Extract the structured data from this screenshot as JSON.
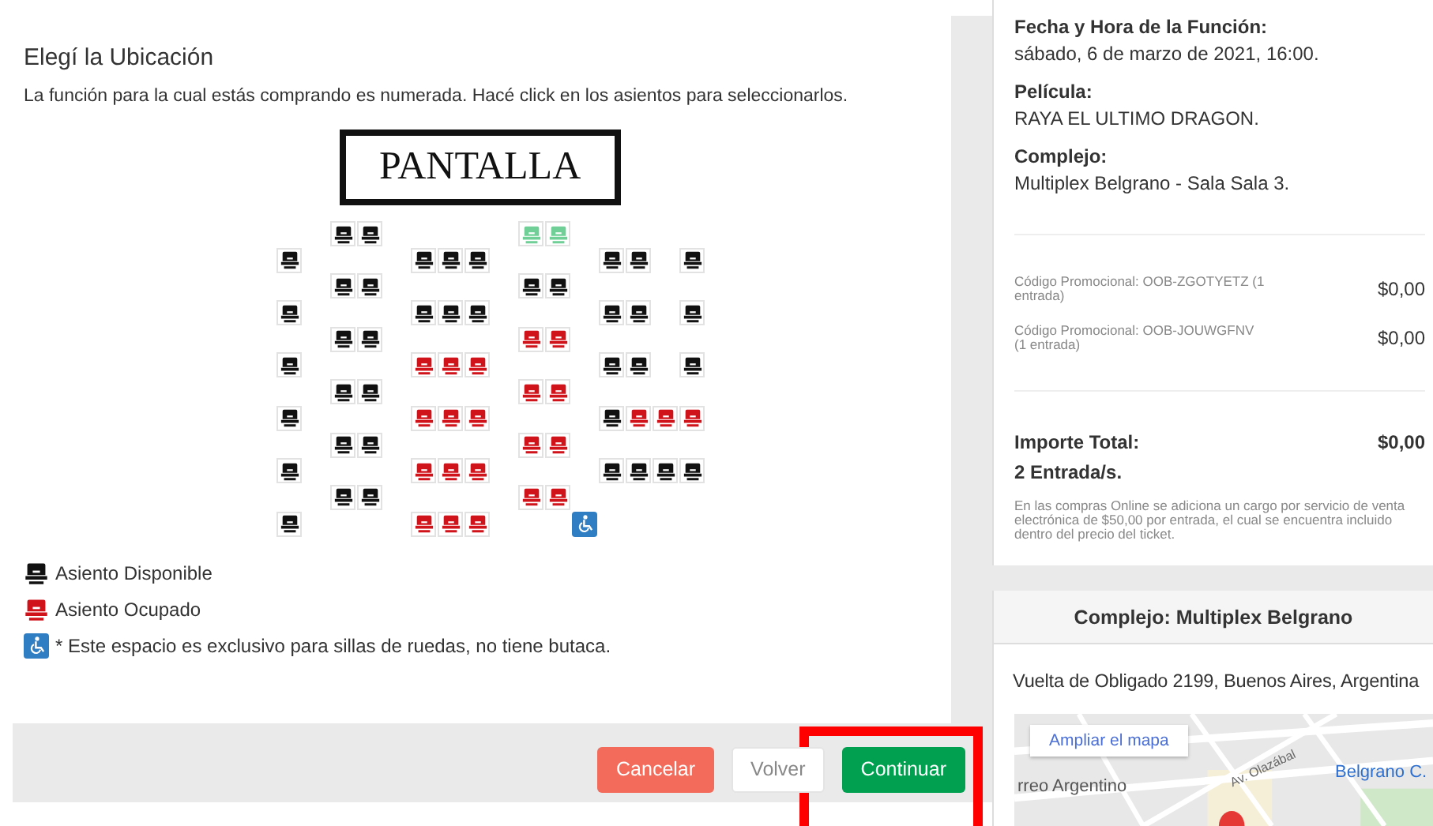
{
  "seat_selection": {
    "title": "Elegí la Ubicación",
    "instructions": "La función para la cual estás comprando es numerada. Hacé click en los asientos para seleccionarlos.",
    "screen_label": "PANTALLA",
    "rows": [
      [
        {
          "kind": "gap"
        },
        {
          "kind": "gap"
        },
        {
          "kind": "free"
        },
        {
          "kind": "free"
        },
        {
          "kind": "gap"
        },
        {
          "kind": "gap"
        },
        {
          "kind": "gap"
        },
        {
          "kind": "gap"
        },
        {
          "kind": "gap"
        },
        {
          "kind": "selected"
        },
        {
          "kind": "selected"
        }
      ],
      [
        {
          "kind": "free"
        },
        {
          "kind": "gap"
        },
        {
          "kind": "gap"
        },
        {
          "kind": "gap"
        },
        {
          "kind": "gap"
        },
        {
          "kind": "free"
        },
        {
          "kind": "free"
        },
        {
          "kind": "free"
        },
        {
          "kind": "gap"
        },
        {
          "kind": "gap"
        },
        {
          "kind": "gap"
        },
        {
          "kind": "gap"
        },
        {
          "kind": "free"
        },
        {
          "kind": "free"
        },
        {
          "kind": "gap"
        },
        {
          "kind": "free"
        }
      ],
      [
        {
          "kind": "gap"
        },
        {
          "kind": "gap"
        },
        {
          "kind": "free"
        },
        {
          "kind": "free"
        },
        {
          "kind": "gap"
        },
        {
          "kind": "gap"
        },
        {
          "kind": "gap"
        },
        {
          "kind": "gap"
        },
        {
          "kind": "gap"
        },
        {
          "kind": "free"
        },
        {
          "kind": "free"
        }
      ],
      [
        {
          "kind": "free"
        },
        {
          "kind": "gap"
        },
        {
          "kind": "gap"
        },
        {
          "kind": "gap"
        },
        {
          "kind": "gap"
        },
        {
          "kind": "free"
        },
        {
          "kind": "free"
        },
        {
          "kind": "free"
        },
        {
          "kind": "gap"
        },
        {
          "kind": "gap"
        },
        {
          "kind": "gap"
        },
        {
          "kind": "gap"
        },
        {
          "kind": "free"
        },
        {
          "kind": "free"
        },
        {
          "kind": "gap"
        },
        {
          "kind": "free"
        }
      ],
      [
        {
          "kind": "gap"
        },
        {
          "kind": "gap"
        },
        {
          "kind": "free"
        },
        {
          "kind": "free"
        },
        {
          "kind": "gap"
        },
        {
          "kind": "gap"
        },
        {
          "kind": "gap"
        },
        {
          "kind": "gap"
        },
        {
          "kind": "gap"
        },
        {
          "kind": "taken"
        },
        {
          "kind": "taken"
        }
      ],
      [
        {
          "kind": "free"
        },
        {
          "kind": "gap"
        },
        {
          "kind": "gap"
        },
        {
          "kind": "gap"
        },
        {
          "kind": "gap"
        },
        {
          "kind": "taken"
        },
        {
          "kind": "taken"
        },
        {
          "kind": "taken"
        },
        {
          "kind": "gap"
        },
        {
          "kind": "gap"
        },
        {
          "kind": "gap"
        },
        {
          "kind": "gap"
        },
        {
          "kind": "free"
        },
        {
          "kind": "free"
        },
        {
          "kind": "gap"
        },
        {
          "kind": "free"
        }
      ],
      [
        {
          "kind": "gap"
        },
        {
          "kind": "gap"
        },
        {
          "kind": "free"
        },
        {
          "kind": "free"
        },
        {
          "kind": "gap"
        },
        {
          "kind": "gap"
        },
        {
          "kind": "gap"
        },
        {
          "kind": "gap"
        },
        {
          "kind": "gap"
        },
        {
          "kind": "taken"
        },
        {
          "kind": "taken"
        }
      ],
      [
        {
          "kind": "free"
        },
        {
          "kind": "gap"
        },
        {
          "kind": "gap"
        },
        {
          "kind": "gap"
        },
        {
          "kind": "gap"
        },
        {
          "kind": "taken"
        },
        {
          "kind": "taken"
        },
        {
          "kind": "taken"
        },
        {
          "kind": "gap"
        },
        {
          "kind": "gap"
        },
        {
          "kind": "gap"
        },
        {
          "kind": "gap"
        },
        {
          "kind": "free"
        },
        {
          "kind": "taken"
        },
        {
          "kind": "taken"
        },
        {
          "kind": "taken"
        }
      ],
      [
        {
          "kind": "gap"
        },
        {
          "kind": "gap"
        },
        {
          "kind": "free"
        },
        {
          "kind": "free"
        },
        {
          "kind": "gap"
        },
        {
          "kind": "gap"
        },
        {
          "kind": "gap"
        },
        {
          "kind": "gap"
        },
        {
          "kind": "gap"
        },
        {
          "kind": "taken"
        },
        {
          "kind": "taken"
        }
      ],
      [
        {
          "kind": "free"
        },
        {
          "kind": "gap"
        },
        {
          "kind": "gap"
        },
        {
          "kind": "gap"
        },
        {
          "kind": "gap"
        },
        {
          "kind": "taken"
        },
        {
          "kind": "taken"
        },
        {
          "kind": "taken"
        },
        {
          "kind": "gap"
        },
        {
          "kind": "gap"
        },
        {
          "kind": "gap"
        },
        {
          "kind": "gap"
        },
        {
          "kind": "free"
        },
        {
          "kind": "free"
        },
        {
          "kind": "free"
        },
        {
          "kind": "free"
        }
      ],
      [
        {
          "kind": "gap"
        },
        {
          "kind": "gap"
        },
        {
          "kind": "free"
        },
        {
          "kind": "free"
        },
        {
          "kind": "gap"
        },
        {
          "kind": "gap"
        },
        {
          "kind": "gap"
        },
        {
          "kind": "gap"
        },
        {
          "kind": "gap"
        },
        {
          "kind": "taken"
        },
        {
          "kind": "taken"
        }
      ],
      [
        {
          "kind": "free"
        },
        {
          "kind": "gap"
        },
        {
          "kind": "gap"
        },
        {
          "kind": "gap"
        },
        {
          "kind": "gap"
        },
        {
          "kind": "taken"
        },
        {
          "kind": "taken"
        },
        {
          "kind": "taken"
        },
        {
          "kind": "gap"
        },
        {
          "kind": "gap"
        },
        {
          "kind": "gap"
        },
        {
          "kind": "wheelchair"
        }
      ]
    ],
    "legend": [
      {
        "kind": "free",
        "label": "Asiento Disponible"
      },
      {
        "kind": "taken",
        "label": "Asiento Ocupado"
      },
      {
        "kind": "wheelchair",
        "label": "* Este espacio es exclusivo para sillas de ruedas, no tiene butaca."
      }
    ]
  },
  "footer": {
    "buttons": [
      {
        "kind": "danger",
        "label": "Cancelar"
      },
      {
        "kind": "default",
        "label": "Volver"
      },
      {
        "kind": "success",
        "label": "Continuar"
      }
    ],
    "highlight_frame": true
  },
  "summary": {
    "details": [
      {
        "label": "Fecha y Hora de la Función:",
        "value": "sábado, 6 de marzo de 2021, 16:00."
      },
      {
        "label": "Película:",
        "value": "RAYA EL ULTIMO DRAGON."
      },
      {
        "label": "Complejo:",
        "value": "Multiplex Belgrano - Sala Sala 3."
      }
    ],
    "promo_lines": [
      {
        "label": "Código Promocional: OOB-ZGOTYETZ (1 entrada)",
        "amount": "$0,00"
      },
      {
        "label": "Código Promocional: OOB-JOUWGFNV (1 entrada)",
        "amount": "$0,00"
      }
    ],
    "total_label": "Importe Total:",
    "total_amount": "$0,00",
    "tickets": "2 Entrada/s.",
    "note": "En las compras Online se adiciona un cargo por servicio de venta electrónica de $50,00 por entrada, el cual se encuentra incluido dentro del precio del ticket."
  },
  "venue": {
    "title": "Complejo: Multiplex Belgrano",
    "address": "Vuelta de Obligado 2199, Buenos Aires, Argentina",
    "map": {
      "link": "Ampliar el mapa",
      "labels": [
        "Av. Olazábal",
        "Belgrano C.",
        "rreo Argentino"
      ]
    }
  }
}
